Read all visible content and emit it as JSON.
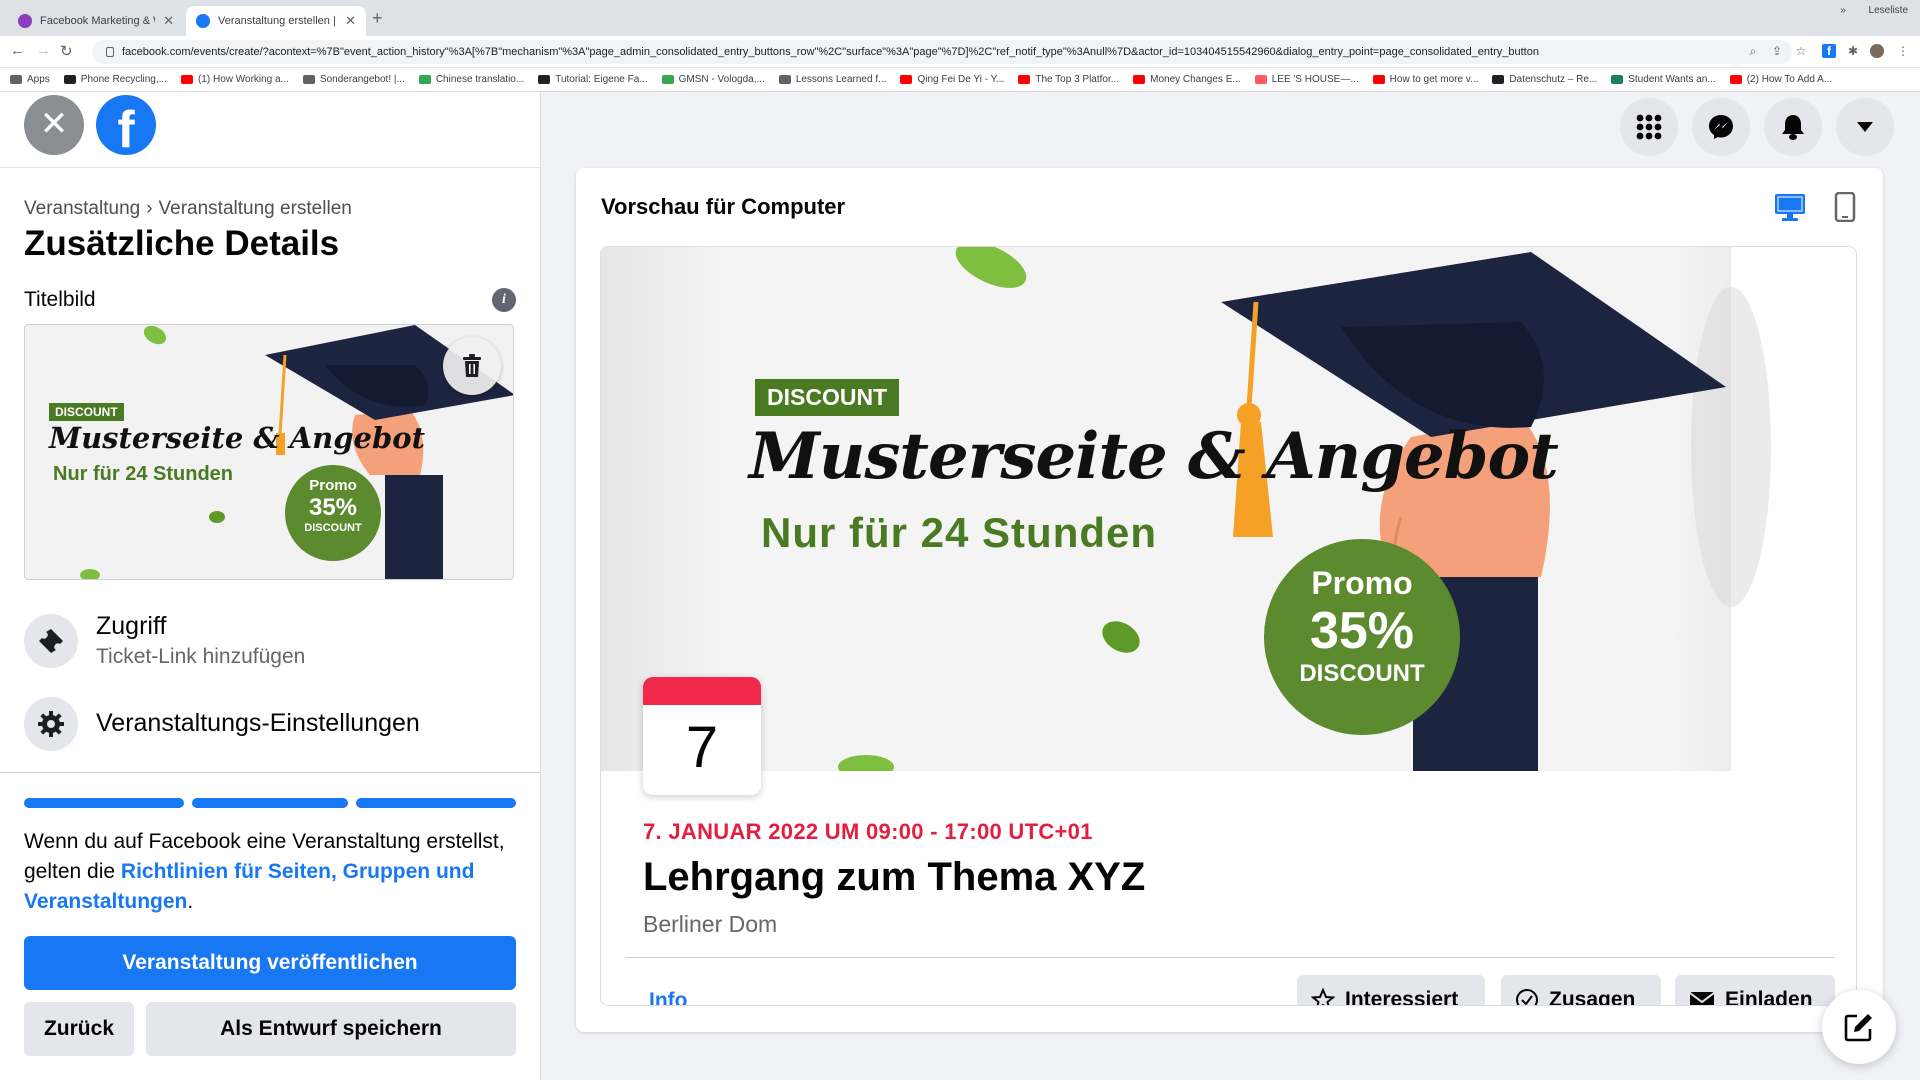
{
  "browser": {
    "tabs": [
      {
        "title": "Facebook Marketing & Werbea",
        "active": false
      },
      {
        "title": "Veranstaltung erstellen | Faceb",
        "active": true
      }
    ],
    "new_tab": "+",
    "url": "facebook.com/events/create/?acontext=%7B\"event_action_history\"%3A[%7B\"mechanism\"%3A\"page_admin_consolidated_entry_buttons_row\"%2C\"surface\"%3A\"page\"%7D]%2C\"ref_notif_type\"%3Anull%7D&actor_id=103404515542960&dialog_entry_point=page_consolidated_entry_button",
    "bookmarks": [
      {
        "label": "Apps",
        "color": "#5f6368"
      },
      {
        "label": "Phone Recycling,...",
        "color": "#202124"
      },
      {
        "label": "(1) How Working a...",
        "color": "#ff0000"
      },
      {
        "label": "Sonderangebot! |...",
        "color": "#5f6368"
      },
      {
        "label": "Chinese translatio...",
        "color": "#34a853"
      },
      {
        "label": "Tutorial: Eigene Fa...",
        "color": "#202124"
      },
      {
        "label": "GMSN - Vologda,...",
        "color": "#34a853"
      },
      {
        "label": "Lessons Learned f...",
        "color": "#5f6368"
      },
      {
        "label": "Qing Fei De Yi - Y...",
        "color": "#ff0000"
      },
      {
        "label": "The Top 3 Platfor...",
        "color": "#ff0000"
      },
      {
        "label": "Money Changes E...",
        "color": "#ff0000"
      },
      {
        "label": "LEE 'S HOUSE—...",
        "color": "#ff5a5f"
      },
      {
        "label": "How to get more v...",
        "color": "#ff0000"
      },
      {
        "label": "Datenschutz – Re...",
        "color": "#202124"
      },
      {
        "label": "Student Wants an...",
        "color": "#1a7f64"
      },
      {
        "label": "(2) How To Add A...",
        "color": "#ff0000"
      }
    ],
    "more": "»",
    "reading_list": "Leseliste"
  },
  "left": {
    "breadcrumb": {
      "parent": "Veranstaltung",
      "sep": "›",
      "current": "Veranstaltung erstellen"
    },
    "title": "Zusätzliche Details",
    "cover_section": "Titelbild",
    "info_icon": "i",
    "access": {
      "title": "Zugriff",
      "subtitle": "Ticket-Link hinzufügen"
    },
    "settings": {
      "title": "Veranstaltungs-Einstellungen"
    },
    "progress_steps": 3,
    "progress_completed": 3,
    "terms": {
      "before": "Wenn du auf Facebook eine Veranstaltung erstellst, gelten die ",
      "link": "Richtlinien für Seiten, Gruppen und Veranstaltungen",
      "after": "."
    },
    "publish_label": "Veranstaltung veröffentlichen",
    "back_label": "Zurück",
    "draft_label": "Als Entwurf speichern"
  },
  "cover_image": {
    "badge": "DISCOUNT",
    "headline": "Musterseite & Angebot",
    "subline": "Nur für 24 Stunden",
    "promo_top": "Promo",
    "promo_pct": "35%",
    "promo_bottom": "DISCOUNT"
  },
  "preview": {
    "title": "Vorschau für Computer",
    "date_day": "7",
    "date_line": "7. JANUAR 2022 UM 09:00 - 17:00 UTC+01",
    "event_title": "Lehrgang zum Thema XYZ",
    "location": "Berliner Dom",
    "tab_info": "Info",
    "btn_interested": "Interessiert",
    "btn_going": "Zusagen",
    "btn_invite": "Einladen"
  },
  "colors": {
    "brand": "#1877f2",
    "date_red": "#e41e3f",
    "promo_green": "#5c8a2e",
    "badge_green": "#4a7a22",
    "cap_navy": "#1c2440",
    "tassel": "#f4a125"
  },
  "icons": [
    "close-icon",
    "facebook-logo",
    "info-icon",
    "trash-icon",
    "ticket-icon",
    "gear-icon",
    "grid-menu-icon",
    "messenger-icon",
    "bell-icon",
    "caret-down-icon",
    "desktop-icon",
    "mobile-icon",
    "star-icon",
    "check-circle-icon",
    "envelope-icon",
    "compose-icon"
  ]
}
